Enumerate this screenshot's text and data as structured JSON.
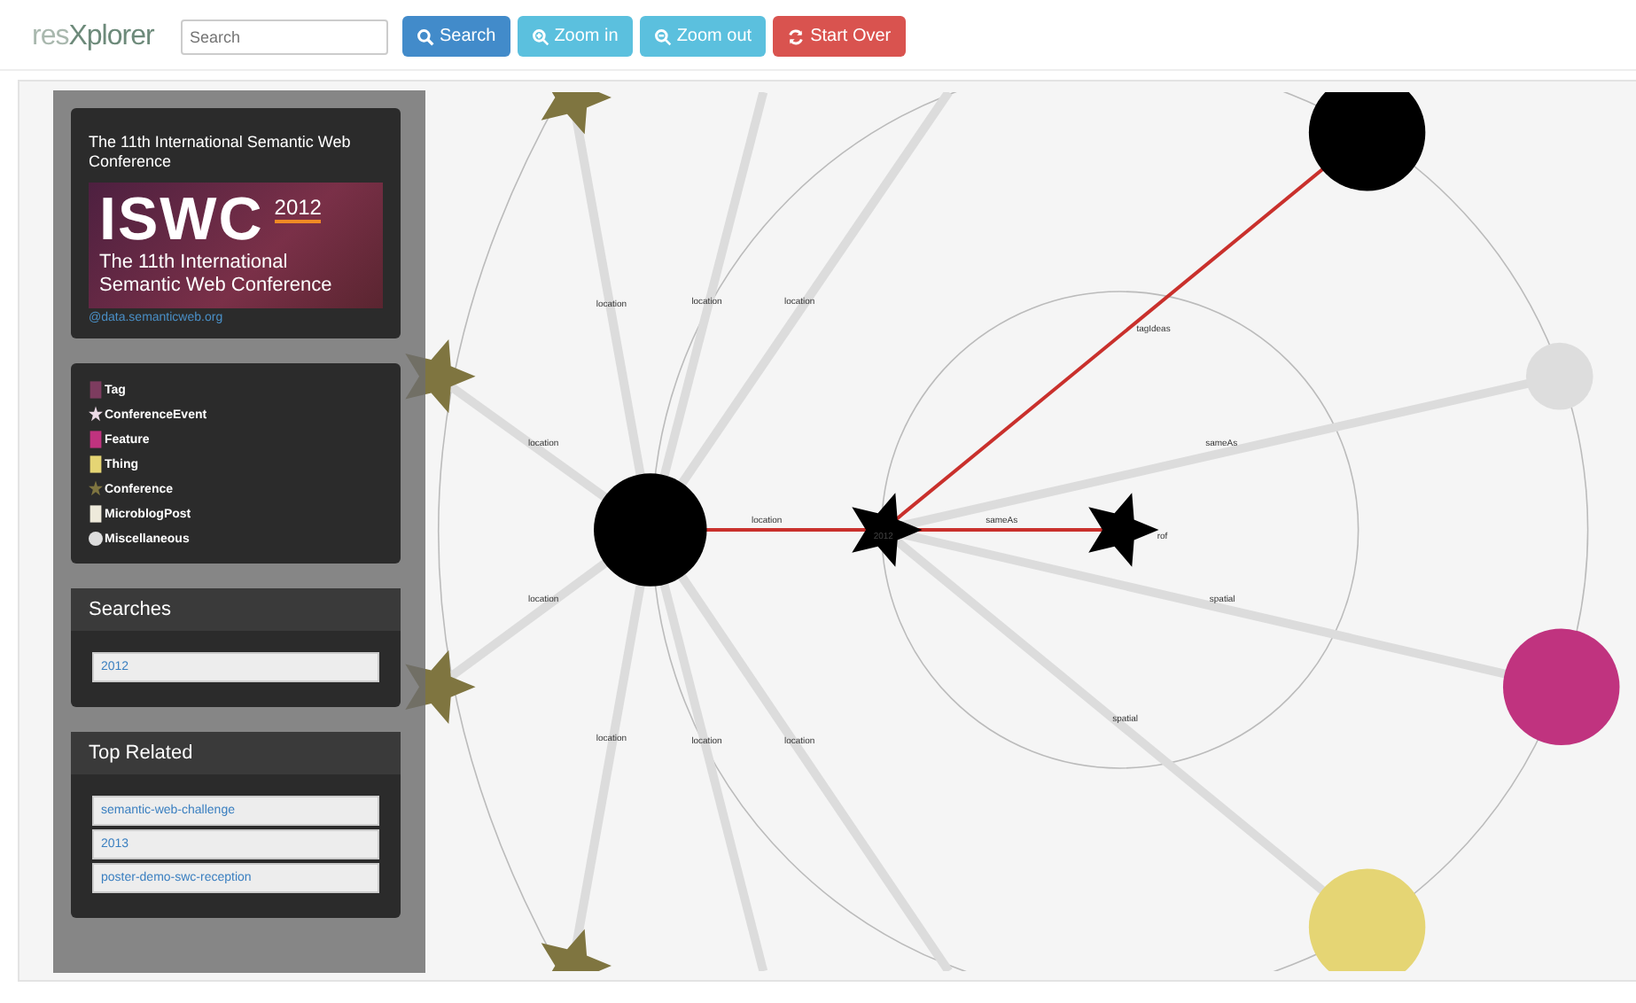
{
  "navbar": {
    "logo_prefix": "res",
    "logo_main": "Xplorer",
    "search": {
      "placeholder": "Search"
    },
    "buttons": [
      {
        "label": "Search",
        "kind": "search"
      },
      {
        "label": "Zoom in",
        "kind": "zoomin"
      },
      {
        "label": "Zoom out",
        "kind": "zoomout"
      },
      {
        "label": "Start Over",
        "kind": "reset"
      }
    ]
  },
  "sidebar": {
    "info": {
      "title": "The 11th International Semantic Web Conference",
      "banner": {
        "acronym": "ISWC",
        "year": "2012",
        "line_1": "The 11th International",
        "line_2": "Semantic Web Conference"
      },
      "source": "@data.semanticweb.org"
    },
    "legend": [
      {
        "label": "Tag",
        "kind": "square",
        "color": "#7d3c5f"
      },
      {
        "label": "ConferenceEvent",
        "kind": "star",
        "color": "#ecd9e6"
      },
      {
        "label": "Feature",
        "kind": "square",
        "color": "#c0337f"
      },
      {
        "label": "Thing",
        "kind": "square",
        "color": "#e5d574"
      },
      {
        "label": "Conference",
        "kind": "star",
        "color": "#7f7540"
      },
      {
        "label": "MicroblogPost",
        "kind": "square",
        "color": "#eeeadb"
      },
      {
        "label": "Miscellaneous",
        "kind": "circle",
        "color": "#dddddd"
      }
    ],
    "searches": {
      "title": "Searches",
      "items": [
        "2012"
      ]
    },
    "top_related": {
      "title": "Top Related",
      "items": [
        "semantic-web-challenge",
        "2013",
        "poster-demo-swc-reception"
      ]
    }
  },
  "graph": {
    "nodes": [
      {
        "kind": "circle",
        "color": "#000000"
      },
      {
        "kind": "star",
        "color": "#7f7540"
      },
      {
        "kind": "star",
        "color": "#7f7540"
      },
      {
        "kind": "star",
        "color": "#7f7540"
      },
      {
        "kind": "star",
        "color": "#7f7540"
      },
      {
        "kind": "star",
        "color": "#000000",
        "label": "2012"
      },
      {
        "kind": "star",
        "color": "#000000",
        "label": "rof"
      },
      {
        "kind": "circle",
        "color": "#000000"
      },
      {
        "kind": "circle",
        "color": "#dddddd"
      },
      {
        "kind": "circle",
        "color": "#c0337f"
      },
      {
        "kind": "circle",
        "color": "#e5d574"
      }
    ],
    "edges": [
      {
        "label": "location",
        "highlighted": false
      },
      {
        "label": "location",
        "highlighted": false
      },
      {
        "label": "location",
        "highlighted": false
      },
      {
        "label": "location",
        "highlighted": false
      },
      {
        "label": "location",
        "highlighted": false
      },
      {
        "label": "location",
        "highlighted": false
      },
      {
        "label": "location",
        "highlighted": false
      },
      {
        "label": "location",
        "highlighted": false
      },
      {
        "label": "location",
        "highlighted": true
      },
      {
        "label": "tagIdeas",
        "highlighted": true
      },
      {
        "label": "sameAs",
        "highlighted": false
      },
      {
        "label": "sameAs",
        "highlighted": true
      },
      {
        "label": "spatial",
        "highlighted": false
      },
      {
        "label": "spatial",
        "highlighted": false
      }
    ]
  }
}
